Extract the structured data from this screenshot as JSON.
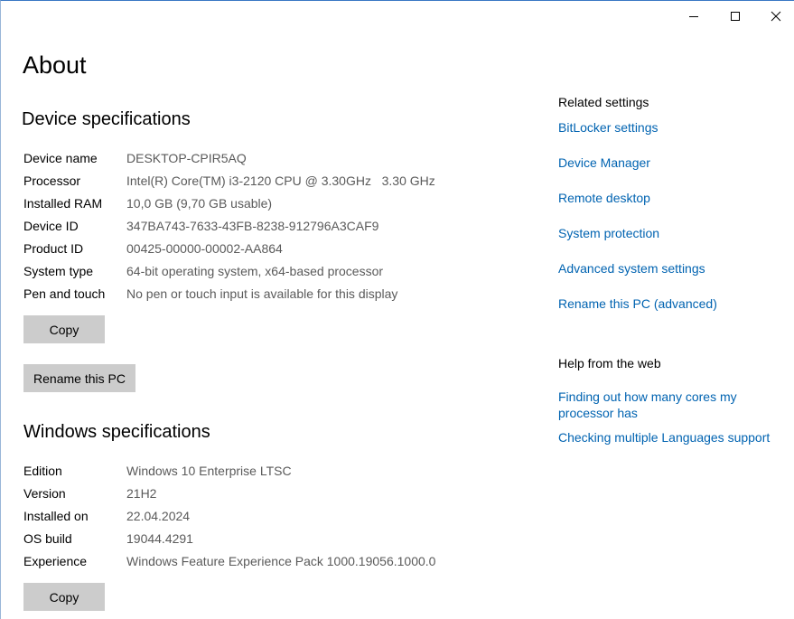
{
  "window": {
    "controls": {
      "minimize": "minimize-icon",
      "maximize": "maximize-icon",
      "close": "close-icon"
    }
  },
  "page": {
    "title": "About"
  },
  "device_specs": {
    "heading": "Device specifications",
    "rows": [
      {
        "key": "Device name",
        "value": "DESKTOP-CPIR5AQ"
      },
      {
        "key": "Processor",
        "value": "Intel(R) Core(TM) i3-2120 CPU @ 3.30GHz   3.30 GHz"
      },
      {
        "key": "Installed RAM",
        "value": "10,0 GB (9,70 GB usable)"
      },
      {
        "key": "Device ID",
        "value": "347BA743-7633-43FB-8238-912796A3CAF9"
      },
      {
        "key": "Product ID",
        "value": "00425-00000-00002-AA864"
      },
      {
        "key": "System type",
        "value": "64-bit operating system, x64-based processor"
      },
      {
        "key": "Pen and touch",
        "value": "No pen or touch input is available for this display"
      }
    ],
    "copy_label": "Copy",
    "rename_label": "Rename this PC"
  },
  "windows_specs": {
    "heading": "Windows specifications",
    "rows": [
      {
        "key": "Edition",
        "value": "Windows 10 Enterprise LTSC"
      },
      {
        "key": "Version",
        "value": "21H2"
      },
      {
        "key": "Installed on",
        "value": "22.04.2024"
      },
      {
        "key": "OS build",
        "value": "19044.4291"
      },
      {
        "key": "Experience",
        "value": "Windows Feature Experience Pack 1000.19056.1000.0"
      }
    ],
    "copy_label": "Copy"
  },
  "related_settings": {
    "heading": "Related settings",
    "links": [
      "BitLocker settings",
      "Device Manager",
      "Remote desktop",
      "System protection",
      "Advanced system settings",
      "Rename this PC (advanced)"
    ]
  },
  "help": {
    "heading": "Help from the web",
    "links": [
      "Finding out how many cores my processor has",
      "Checking multiple Languages support"
    ]
  },
  "colors": {
    "link": "#0063b1",
    "button_bg": "#cccccc",
    "value_text": "#5a5a5a"
  }
}
